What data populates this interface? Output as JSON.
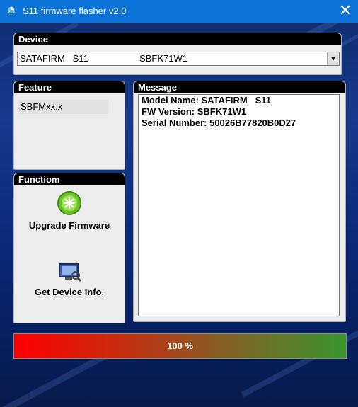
{
  "window": {
    "title": "S11 firmware flasher v2.0",
    "close_symbol": "✕"
  },
  "device": {
    "header": "Device",
    "selected": "SATAFIRM   S11                    SBFK71W1",
    "dropdown_icon": "chevron-down-icon"
  },
  "feature": {
    "header": "Feature",
    "item": "SBFMxx.x"
  },
  "function": {
    "header": "Functiom",
    "upgrade_label": "Upgrade Firmware",
    "info_label": "Get Device Info."
  },
  "message": {
    "header": "Message",
    "lines": [
      "Model Name: SATAFIRM   S11",
      "FW Version: SBFK71W1",
      "Serial Number: 50026B77820B0D27"
    ]
  },
  "progress": {
    "value": 1.0,
    "label": "100 %"
  },
  "colors": {
    "titlebar": "#0c73d8",
    "panel_header": "#000000",
    "panel_bg": "#ececec"
  }
}
